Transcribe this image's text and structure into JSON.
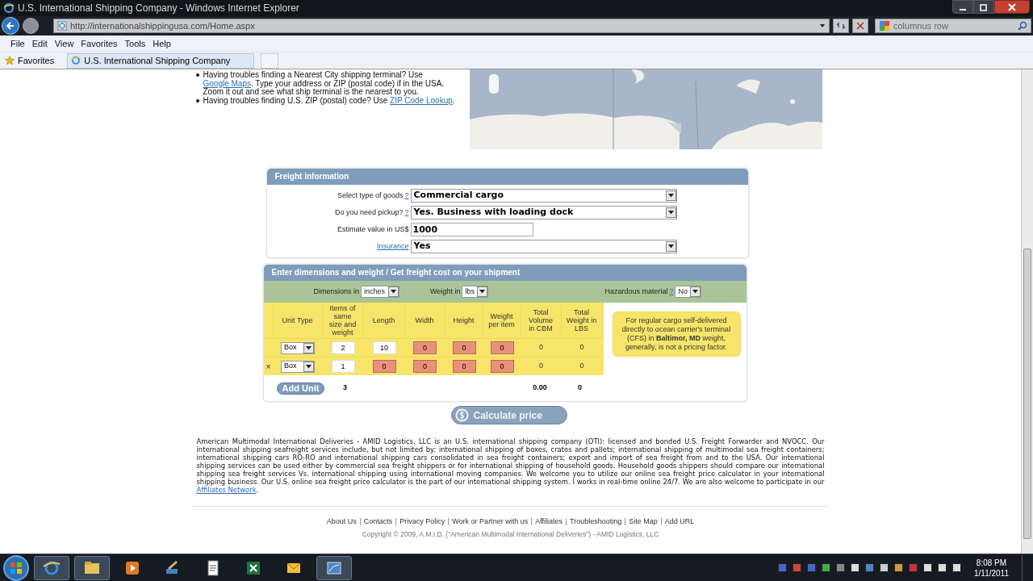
{
  "window": {
    "title": "U.S. International Shipping Company - Windows Internet Explorer",
    "address": "http://internationalshippingusa.com/Home.aspx",
    "search": "columnus row"
  },
  "menu": [
    "File",
    "Edit",
    "View",
    "Favorites",
    "Tools",
    "Help"
  ],
  "favorites_bar": {
    "label": "Favorites",
    "tab": "U.S. International Shipping Company"
  },
  "tips": [
    {
      "parts": [
        {
          "kind": "text",
          "text": "Having troubles finding a Nearest City shipping terminal? Use "
        },
        {
          "kind": "link",
          "text": "Google Maps"
        },
        {
          "kind": "text",
          "text": ". Type your address or ZIP (postal code) if in the USA. Zoom it out and see what ship terminal is the nearest to you."
        }
      ]
    },
    {
      "parts": [
        {
          "kind": "text",
          "text": "Having troubles finding U.S. ZIP (postal) code? Use "
        },
        {
          "kind": "link",
          "text": "ZIP Code Lookup"
        },
        {
          "kind": "text",
          "text": "."
        }
      ]
    }
  ],
  "freight": {
    "title": "Freight information",
    "fields": [
      {
        "kind": "select",
        "label": "Select type of goods",
        "help": "?",
        "value": "Commercial cargo"
      },
      {
        "kind": "select",
        "label": "Do you need pickup?",
        "help": "?",
        "value": "Yes. Business with loading dock"
      },
      {
        "kind": "input",
        "label": "Estimate value in US$",
        "value": "1000"
      },
      {
        "kind": "link-select",
        "label": "Insurance",
        "value": "Yes"
      }
    ]
  },
  "dimensions": {
    "title": "Enter dimensions and weight / Get freight cost on your shipment",
    "units": [
      {
        "label": "Dimensions in",
        "value": "inches"
      },
      {
        "label": "Weight in",
        "value": "lbs"
      },
      {
        "label": "Hazardous material",
        "help": "?",
        "value": "No"
      }
    ],
    "columns": [
      "Unit Type",
      "Items of same size and weight",
      "Length",
      "Width",
      "Height",
      "Weight per item",
      "Total Volume in CBM",
      "Total Weight in LBS"
    ],
    "rows": [
      {
        "cells": [
          {
            "kind": "select",
            "value": "Box"
          },
          {
            "kind": "input",
            "value": "2",
            "invalid": false
          },
          {
            "kind": "input",
            "value": "10",
            "invalid": false
          },
          {
            "kind": "input",
            "value": "0",
            "invalid": true
          },
          {
            "kind": "input",
            "value": "0",
            "invalid": true
          },
          {
            "kind": "input",
            "value": "0",
            "invalid": true
          },
          {
            "kind": "text",
            "value": "0"
          },
          {
            "kind": "text",
            "value": "0"
          }
        ]
      },
      {
        "remove": "×",
        "cells": [
          {
            "kind": "select",
            "value": "Box"
          },
          {
            "kind": "input",
            "value": "1",
            "invalid": false
          },
          {
            "kind": "input",
            "value": "0",
            "invalid": true
          },
          {
            "kind": "input",
            "value": "0",
            "invalid": true
          },
          {
            "kind": "input",
            "value": "0",
            "invalid": true
          },
          {
            "kind": "input",
            "value": "0",
            "invalid": true
          },
          {
            "kind": "text",
            "value": "0"
          },
          {
            "kind": "text",
            "value": "0"
          }
        ]
      }
    ],
    "note": "For regular cargo self-delivered directly to ocean carrier's terminal (CFS) in **Baltimor, MD** weight, generally, is not a pricing factor.",
    "add_button": "Add Unit",
    "total_items": "3",
    "total_volume": "0.00",
    "total_weight": "0"
  },
  "calculate_button": "Calculate price",
  "about": {
    "text": "American Multimodal International Deliveries - AMID Logistics, LLC is an U.S. international shipping company (OTI): licensed and bonded U.S. Freight Forwarder and NVOCC. Our international shipping seafreight services include, but not limited by: international shipping of boxes, crates and pallets; international shipping of multimodal sea freight containers; international shipping cars RO-RO and international shipping cars consolidated in sea freight containers; export and import of sea freight from and to the USA. Our international shipping services can be used either by commercial sea freight shippers or for international shipping of household goods. Household goods shippers should compare our international shipping sea freight services Vs. international shipping using international moving companies. We welcome you to utilize our online sea freight price calculator in your international shipping business. Our U.S. online sea freight price calculator is the part of our international shipping system. I works in real-time online 24/7. We are also welcome to participate in our ",
    "link": "Affiliates Network",
    "end": "."
  },
  "footer_links": [
    "About Us",
    "Contacts",
    "Privacy Policy",
    "Work or Partner with us",
    "Affiliates",
    "Troubleshooting",
    "Site Map",
    "Add URL"
  ],
  "copyright": "Copyright © 2009, A.M.I.D. (\"American Multimodal International Deliveries\") - AMID Logistics, LLC",
  "taskbar": {
    "time": "8:08 PM",
    "date": "1/11/2011"
  }
}
